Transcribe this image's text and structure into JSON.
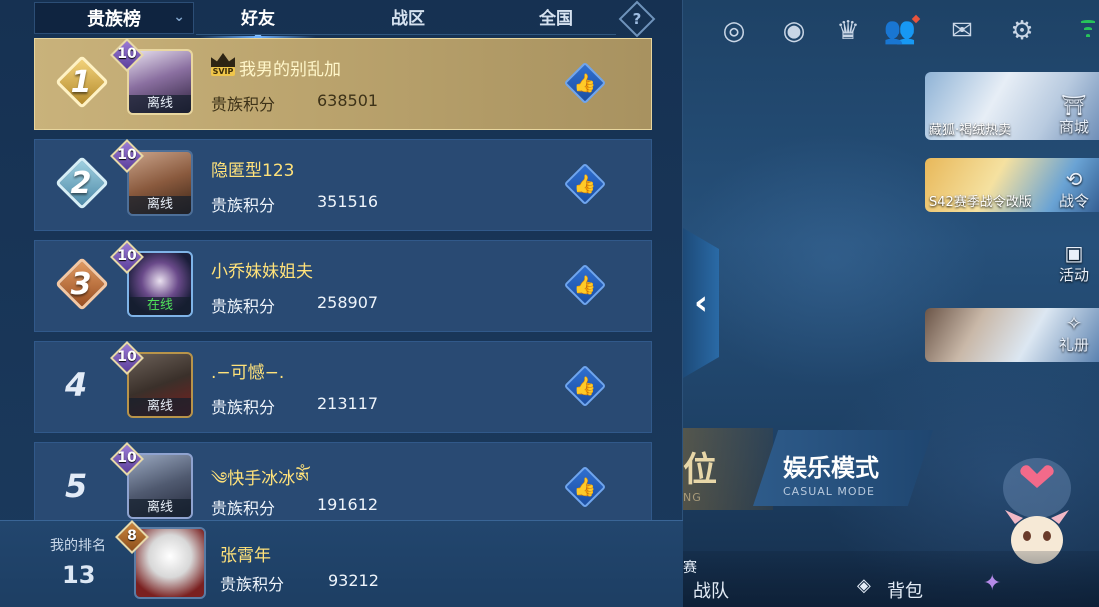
{
  "leaderboard": {
    "dropdown_label": "贵族榜",
    "tabs": [
      {
        "label": "好友",
        "active": true
      },
      {
        "label": "战区",
        "active": false
      },
      {
        "label": "全国",
        "active": false
      }
    ],
    "help_label": "?",
    "score_label": "贵族积分",
    "entries": [
      {
        "rank": "1",
        "name": "我男的别乱加",
        "level": "10",
        "status": "离线",
        "score": "638501",
        "svip_badge": "SVIP",
        "highlight": true
      },
      {
        "rank": "2",
        "name": "隐匿型123",
        "level": "10",
        "status": "离线",
        "score": "351516"
      },
      {
        "rank": "3",
        "name": "小乔妹妹姐夫",
        "level": "10",
        "status": "在线",
        "score": "258907"
      },
      {
        "rank": "4",
        "name": ".−可憾−.",
        "level": "10",
        "status": "离线",
        "score": "213117"
      },
      {
        "rank": "5",
        "name": "༄快手冰冰ༀ",
        "level": "10",
        "status": "离线",
        "score": "191612"
      }
    ],
    "my_rank": {
      "label": "我的排名",
      "rank": "13",
      "name": "张霄年",
      "level": "8",
      "score": "93212"
    }
  },
  "background": {
    "promos": [
      {
        "caption": "藏狐·褐绒热卖",
        "side_label": "商城"
      },
      {
        "caption": "S42赛季战令改版",
        "side_label": "战令"
      },
      {
        "caption": "",
        "side_label": "礼册"
      }
    ],
    "activity_label": "活动",
    "mode_rank_label": "位",
    "mode_rank_sub": "NG",
    "mode_casual_label": "娱乐模式",
    "mode_casual_sub": "CASUAL MODE",
    "bottom": {
      "team_label": "战队",
      "bag_label": "背包",
      "partial_label": "赛"
    }
  },
  "colors": {
    "panel_bg": "#163152",
    "row_bg": "#294a73",
    "gold_row": "#c9b27b",
    "name_yellow": "#ffe27a",
    "online_green": "#4fe05a",
    "like_blue": "#2f6fd0"
  },
  "icons": [
    "chevron-down-icon",
    "help-icon",
    "thumbs-up-icon",
    "level-gem-icon",
    "rank-badge-icon",
    "collapse-arrow-icon",
    "settings-gear-icon",
    "mail-icon",
    "friends-icon",
    "trophy-icon",
    "eye-icon",
    "target-icon",
    "wifi-icon"
  ]
}
